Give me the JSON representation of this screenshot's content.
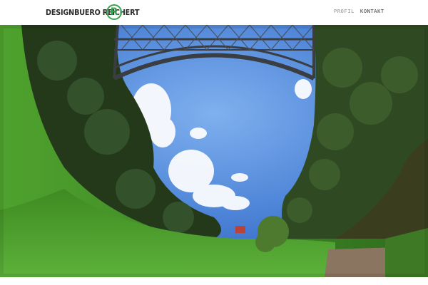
{
  "header": {
    "logo": {
      "text": "DESIGNBUERO REICHERT",
      "mark": "R",
      "mark_color": "#3aa350"
    },
    "nav": {
      "items": [
        {
          "label": "PROFIL",
          "color": "#8c8c8c"
        },
        {
          "label": "KONTAKT",
          "color": "#333333"
        }
      ]
    }
  },
  "hero": {
    "colors": {
      "sky": "#4b82d6",
      "grass": "#4ea42e",
      "trees": "#2f4a22",
      "bridge": "#3a3d42",
      "water": "#3a3e1f"
    }
  }
}
